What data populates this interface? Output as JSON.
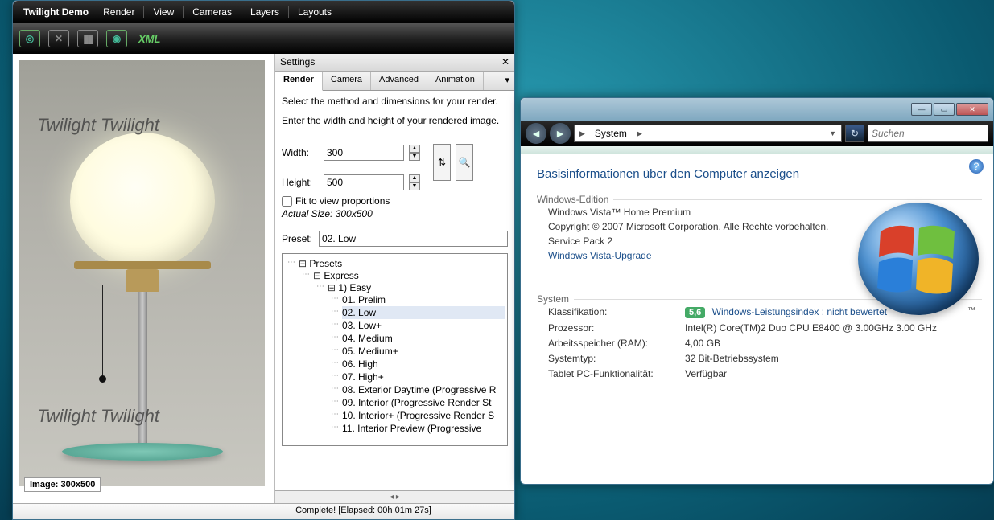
{
  "twilight": {
    "title": "Twilight Demo",
    "menus": [
      "Render",
      "View",
      "Cameras",
      "Layers",
      "Layouts"
    ],
    "toolbar_xml": "XML",
    "watermark": "Twilight Twilight",
    "image_label": "Image: 300x500",
    "settings": {
      "title": "Settings",
      "tabs": [
        "Render",
        "Camera",
        "Advanced",
        "Animation"
      ],
      "intro1": "Select the method and dimensions for your render.",
      "intro2": "Enter the width and height of your rendered image.",
      "width_label": "Width:",
      "width_value": "300",
      "height_label": "Height:",
      "height_value": "500",
      "fit_label": "Fit to view proportions",
      "actual": "Actual Size: 300x500",
      "preset_label": "Preset:",
      "preset_value": "02. Low",
      "tree_root": "Presets",
      "tree_group1": "Express",
      "tree_group2": "1) Easy",
      "presets": [
        "01. Prelim",
        "02. Low",
        "03. Low+",
        "04. Medium",
        "05. Medium+",
        "06. High",
        "07. High+",
        "08. Exterior Daytime (Progressive R",
        "09. Interior (Progressive Render St",
        "10. Interior+ (Progressive Render S",
        "11. Interior Preview (Progressive"
      ]
    },
    "status": "Complete!  [Elapsed: 00h 01m 27s]"
  },
  "vista": {
    "crumb_arrow": "▶",
    "crumb_item": "System",
    "search_placeholder": "Suchen",
    "title": "Basisinformationen über den Computer anzeigen",
    "edition_h": "Windows-Edition",
    "edition_name": "Windows Vista™ Home Premium",
    "copyright": "Copyright © 2007 Microsoft Corporation. Alle Rechte vorbehalten.",
    "sp": "Service Pack 2",
    "upgrade_link": "Windows Vista-Upgrade",
    "system_h": "System",
    "rows": {
      "klass_k": "Klassifikation:",
      "klass_badge": "5,6",
      "klass_link": "Windows-Leistungsindex : nicht bewertet",
      "cpu_k": "Prozessor:",
      "cpu_v": "Intel(R) Core(TM)2 Duo CPU     E8400  @ 3.00GHz   3.00 GHz",
      "ram_k": "Arbeitsspeicher (RAM):",
      "ram_v": "4,00 GB",
      "type_k": "Systemtyp:",
      "type_v": "32 Bit-Betriebssystem",
      "tablet_k": "Tablet PC-Funktionalität:",
      "tablet_v": "Verfügbar"
    },
    "tm": "™"
  }
}
